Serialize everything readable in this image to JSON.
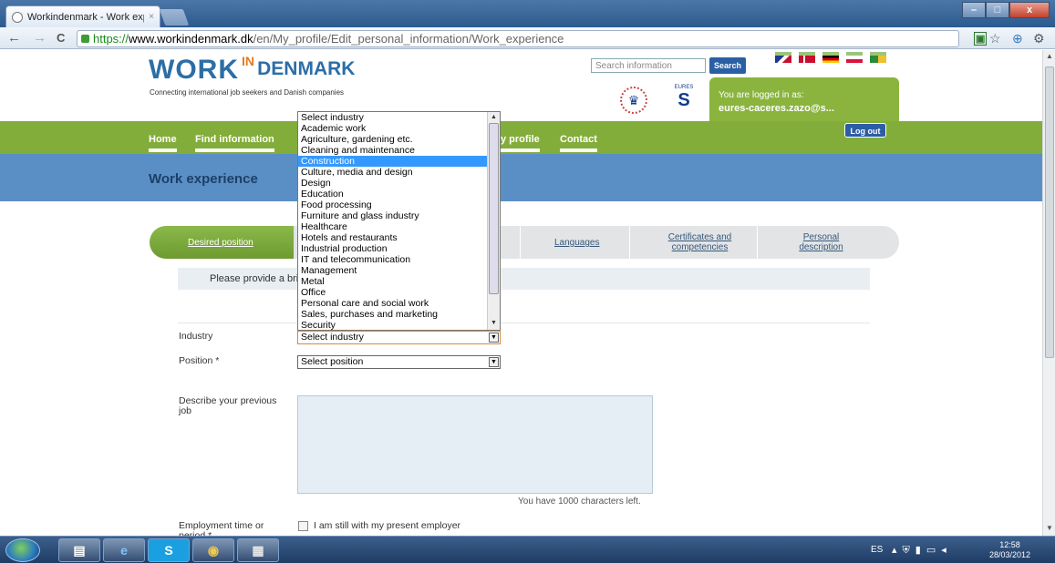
{
  "browser": {
    "tab_title": "Workindenmark - Work exp",
    "tab_close": "×",
    "url_https": "https://",
    "url_domain": "www.workindenmark.dk",
    "url_path": "/en/My_profile/Edit_personal_information/Work_experience",
    "back": "←",
    "forward": "→",
    "reload": "C",
    "star": "☆",
    "wrench": "🔧",
    "ext": "⊕",
    "window_minimize": "–",
    "window_maximize": "□",
    "window_close": "x"
  },
  "header": {
    "logo_work": "WORK",
    "logo_in": "IN",
    "logo_denmark": "DENMARK",
    "tagline": "Connecting international job seekers and Danish companies",
    "search_placeholder": "Search information",
    "search_button": "Search",
    "eures_text": "EURES",
    "login_label": "You are logged in as:",
    "login_user": "eures-caceres.zazo@s..."
  },
  "nav": {
    "home": "Home",
    "find_information": "Find information",
    "my_profile": "y profile",
    "contact": "Contact",
    "logout": "Log out"
  },
  "page": {
    "title": "Work experience",
    "info_text": "Please provide a brie"
  },
  "tabs": {
    "desired_position": "Desired position",
    "languages": "Languages",
    "certificates": "Certificates and competencies",
    "personal": "Personal description"
  },
  "form": {
    "industry_label": "Industry",
    "industry_value": "Select industry",
    "position_label": "Position *",
    "position_value": "Select position",
    "describe_label": "Describe your previous job",
    "char_count": "You have 1000 characters left.",
    "employment_label": "Employment time or period *",
    "present_employer": "I am still with my present employer"
  },
  "industry_options": [
    "Select industry",
    "Academic work",
    "Agriculture, gardening etc.",
    "Cleaning and maintenance",
    "Construction",
    "Culture, media and design",
    "Design",
    "Education",
    "Food processing",
    "Furniture and glass industry",
    "Healthcare",
    "Hotels and restaurants",
    "Industrial production",
    "IT and telecommunication",
    "Management",
    "Metal",
    "Office",
    "Personal care and social work",
    "Sales, purchases and marketing",
    "Security"
  ],
  "highlighted_option": "Construction",
  "taskbar": {
    "language": "ES",
    "time": "12:58",
    "date": "28/03/2012",
    "skype": "S"
  },
  "colors": {
    "nav_green": "#83ad3a",
    "band_blue": "#5a8fc6",
    "brand_blue": "#2c6ea6",
    "accent_orange": "#e37b21"
  }
}
